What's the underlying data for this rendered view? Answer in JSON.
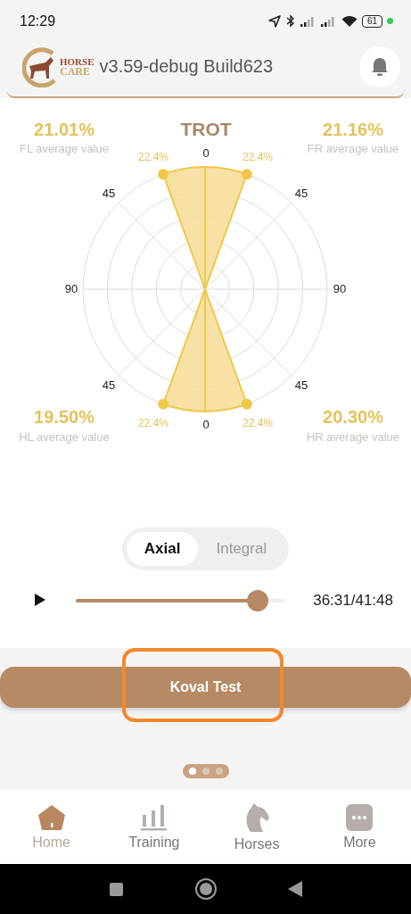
{
  "status_bar": {
    "time": "12:29",
    "battery": "61"
  },
  "header": {
    "logo_lines": [
      "HORSE",
      "CARE"
    ],
    "version": "v3.59-debug Build623"
  },
  "gait": {
    "title": "TROT",
    "averages": [
      {
        "value": "21.01%",
        "label": "FL average value"
      },
      {
        "value": "21.16%",
        "label": "FR average value"
      },
      {
        "value": "19.50%",
        "label": "HL average value"
      },
      {
        "value": "20.30%",
        "label": "HR average value"
      }
    ],
    "angle_labels": [
      "0",
      "45",
      "45",
      "90",
      "90",
      "45",
      "45",
      "0"
    ],
    "sectors": [
      {
        "label": "22.4%"
      },
      {
        "label": "22.4%"
      },
      {
        "label": "22.4%"
      },
      {
        "label": "22.4%"
      }
    ]
  },
  "view_toggle": [
    {
      "label": "Axial",
      "selected": true
    },
    {
      "label": "Integral",
      "selected": false
    }
  ],
  "player": {
    "level": 0.87,
    "time": "36:31/41:48"
  },
  "horse_button": {
    "label": "Koval Test"
  },
  "pager": [
    {
      "selected": true
    },
    {
      "selected": false
    },
    {
      "selected": false
    }
  ],
  "nav": [
    {
      "kind": "home",
      "label": "Home",
      "selected": true
    },
    {
      "kind": "training",
      "label": "Training",
      "selected": false
    },
    {
      "kind": "horses",
      "label": "Horses",
      "selected": false
    },
    {
      "kind": "more",
      "label": "More",
      "selected": false
    }
  ]
}
